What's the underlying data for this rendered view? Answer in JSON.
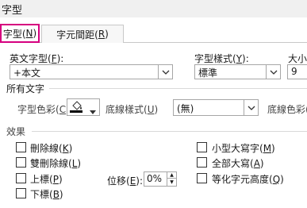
{
  "window": {
    "title": "字型"
  },
  "tabs": [
    {
      "label": "字型(",
      "key": "N",
      "suffix": ")"
    },
    {
      "label": "字元間距(",
      "key": "R",
      "suffix": ")"
    }
  ],
  "fields": {
    "latin_font": {
      "label": "英文字型(",
      "key": "F",
      "suffix": "):",
      "value": "+本文"
    },
    "font_style": {
      "label": "字型樣式(",
      "key": "Y",
      "suffix": "):",
      "value": "標準"
    },
    "size": {
      "label": "大小",
      "value": "9"
    }
  },
  "all_text": {
    "heading": "所有文字",
    "font_color_label": "字型色彩(",
    "font_color_key": "C",
    "font_color_suffix": ")",
    "underline_style_label": "底線樣式(",
    "underline_style_key": "U",
    "underline_style_suffix": ")",
    "underline_style_value": "(無)",
    "underline_color_label": "底線色彩("
  },
  "effects": {
    "heading": "效果",
    "left": [
      {
        "label": "刪除線(",
        "key": "K",
        "suffix": ")"
      },
      {
        "label": "雙刪除線(",
        "key": "L",
        "suffix": ")"
      },
      {
        "label": "上標(",
        "key": "P",
        "suffix": ")"
      },
      {
        "label": "下標(",
        "key": "B",
        "suffix": ")"
      }
    ],
    "right": [
      {
        "label": "小型大寫字(",
        "key": "M",
        "suffix": ")"
      },
      {
        "label": "全部大寫(",
        "key": "A",
        "suffix": ")"
      },
      {
        "label": "等化字元高度(",
        "key": "Q",
        "suffix": ")"
      }
    ],
    "offset_label": "位移(",
    "offset_key": "E",
    "offset_suffix": "):",
    "offset_value": "0%"
  },
  "colors": {
    "accent_tab_border": "#d6007f",
    "font_color_swatch": "#000000"
  }
}
